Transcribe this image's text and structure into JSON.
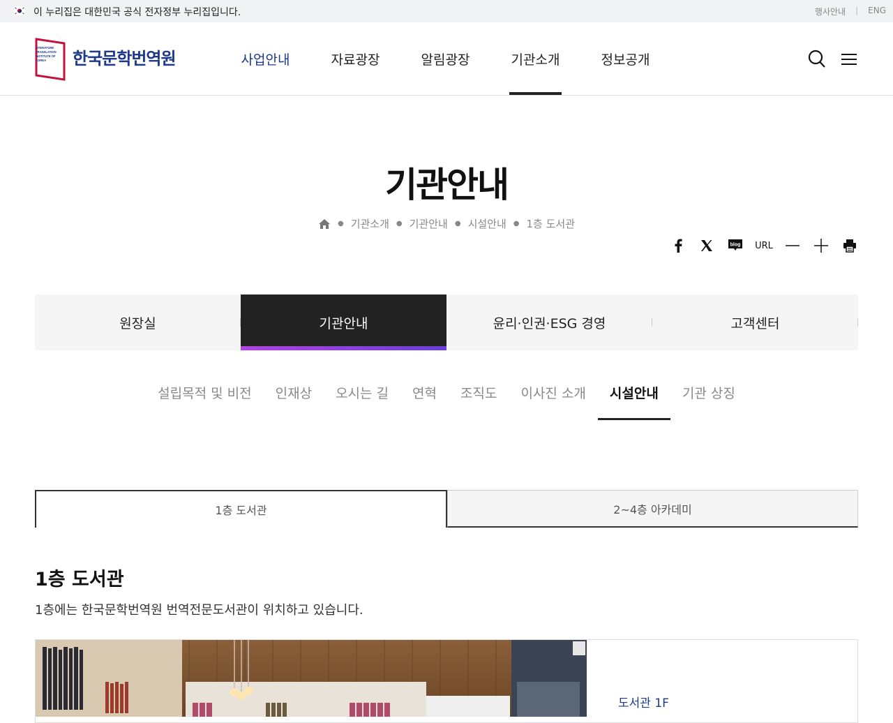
{
  "topbar": {
    "gov_notice": "이 누리집은 대한민국 공식 전자정부 누리집입니다.",
    "links": [
      "행사안내",
      "ENG"
    ]
  },
  "header": {
    "logo_small": [
      "LITERATURE",
      "TRANSLATION",
      "INSTITUTE OF",
      "KOREA"
    ],
    "logo_name": "한국문학번역원",
    "gnb": [
      "사업안내",
      "자료광장",
      "알림광장",
      "기관소개",
      "정보공개"
    ],
    "active_gnb": "기관소개",
    "search_icon": "search-icon",
    "menu_icon": "hamburger-menu-icon"
  },
  "page": {
    "title": "기관안내",
    "breadcrumb": [
      "기관소개",
      "기관안내",
      "시설안내",
      "1층 도서관"
    ]
  },
  "share": {
    "items": [
      "facebook-icon",
      "x-icon",
      "blog-icon",
      "URL",
      "font-smaller-icon",
      "font-larger-icon",
      "print-icon"
    ],
    "url_label": "URL",
    "blog_label": "blog"
  },
  "tabs": [
    "원장실",
    "기관안내",
    "윤리·인권·ESG 경영",
    "고객센터"
  ],
  "subnav": [
    "설립목적 및 비전",
    "인재상",
    "오시는 길",
    "연혁",
    "조직도",
    "이사진 소개",
    "시설안내",
    "기관 상징"
  ],
  "floor_tabs": [
    "1층 도서관",
    "2~4층 아카데미"
  ],
  "section": {
    "title": "1층 도서관",
    "desc": "1층에는 한국문학번역원 번역전문도서관이 위치하고 있습니다.",
    "caption": "도서관 1F"
  },
  "colors": {
    "brand": "#1d3a8a",
    "accent": "#c0143c",
    "dark": "#222222"
  }
}
